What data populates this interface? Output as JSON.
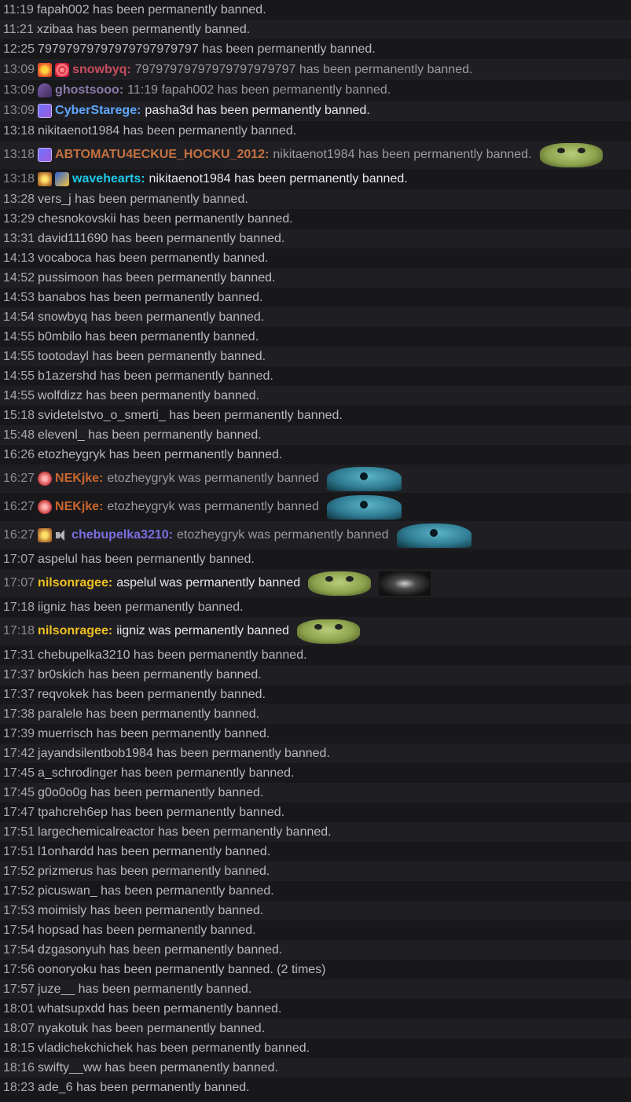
{
  "rows": [
    {
      "time": "11:19",
      "text": "fapah002 has been permanently banned."
    },
    {
      "time": "11:21",
      "text": "xzibaa has been permanently banned."
    },
    {
      "time": "12:25",
      "text": "79797979797979797979797 has been permanently banned."
    },
    {
      "time": "13:09",
      "user": "snowbyq:",
      "text": "79797979797979797979797 has been permanently banned."
    },
    {
      "time": "13:09",
      "user": "ghostsooo:",
      "text": "11:19 fapah002 has been permanently banned."
    },
    {
      "time": "13:09",
      "user": "CyberStarege:",
      "text": "pasha3d has been permanently banned."
    },
    {
      "time": "13:18",
      "text": "nikitaenot1984 has been permanently banned."
    },
    {
      "time": "13:18",
      "user": "ABTOMATU4ECKUE_HOCKU_2012:",
      "text": "nikitaenot1984 has been permanently banned."
    },
    {
      "time": "13:18",
      "user": "wavehearts:",
      "text": "nikitaenot1984 has been permanently banned."
    },
    {
      "time": "13:28",
      "text": "vers_j has been permanently banned."
    },
    {
      "time": "13:29",
      "text": "chesnokovskii has been permanently banned."
    },
    {
      "time": "13:31",
      "text": "david111690 has been permanently banned."
    },
    {
      "time": "14:13",
      "text": "vocaboca has been permanently banned."
    },
    {
      "time": "14:52",
      "text": "pussimoon has been permanently banned."
    },
    {
      "time": "14:53",
      "text": "banabos has been permanently banned."
    },
    {
      "time": "14:54",
      "text": "snowbyq has been permanently banned."
    },
    {
      "time": "14:55",
      "text": "b0mbilo has been permanently banned."
    },
    {
      "time": "14:55",
      "text": "tootodayl has been permanently banned."
    },
    {
      "time": "14:55",
      "text": "b1azershd has been permanently banned."
    },
    {
      "time": "14:55",
      "text": "wolfdizz has been permanently banned."
    },
    {
      "time": "15:18",
      "text": "svidetelstvo_o_smerti_ has been permanently banned."
    },
    {
      "time": "15:48",
      "text": "elevenl_ has been permanently banned."
    },
    {
      "time": "16:26",
      "text": "etozheygryk has been permanently banned."
    },
    {
      "time": "16:27",
      "user": "NEKjke:",
      "text": "etozheygryk was permanently banned"
    },
    {
      "time": "16:27",
      "user": "NEKjke:",
      "text": "etozheygryk was permanently banned"
    },
    {
      "time": "16:27",
      "user": "chebupelka3210:",
      "text": "etozheygryk was permanently banned"
    },
    {
      "time": "17:07",
      "text": "aspelul has been permanently banned."
    },
    {
      "time": "17:07",
      "user": "nilsonragee:",
      "text": "aspelul was permanently banned"
    },
    {
      "time": "17:18",
      "text": "iigniz has been permanently banned."
    },
    {
      "time": "17:18",
      "user": "nilsonragee:",
      "text": "iigniz was permanently banned"
    },
    {
      "time": "17:31",
      "text": "chebupelka3210 has been permanently banned."
    },
    {
      "time": "17:37",
      "text": "br0skich has been permanently banned."
    },
    {
      "time": "17:37",
      "text": "reqvokek has been permanently banned."
    },
    {
      "time": "17:38",
      "text": "paralele has been permanently banned."
    },
    {
      "time": "17:39",
      "text": "muerrisch has been permanently banned."
    },
    {
      "time": "17:42",
      "text": "jayandsilentbob1984 has been permanently banned."
    },
    {
      "time": "17:45",
      "text": "a_schrodinger has been permanently banned."
    },
    {
      "time": "17:45",
      "text": "g0o0o0g has been permanently banned."
    },
    {
      "time": "17:47",
      "text": "tpahcreh6ep has been permanently banned."
    },
    {
      "time": "17:51",
      "text": "largechemicalreactor has been permanently banned."
    },
    {
      "time": "17:51",
      "text": "l1onhardd has been permanently banned."
    },
    {
      "time": "17:52",
      "text": "prizmerus has been permanently banned."
    },
    {
      "time": "17:52",
      "text": "picuswan_ has been permanently banned."
    },
    {
      "time": "17:53",
      "text": "moimisly has been permanently banned."
    },
    {
      "time": "17:54",
      "text": "hopsad has been permanently banned."
    },
    {
      "time": "17:54",
      "text": "dzgasonyuh has been permanently banned."
    },
    {
      "time": "17:56",
      "text": "oonoryoku has been permanently banned. (2 times)"
    },
    {
      "time": "17:57",
      "text": "juze__ has been permanently banned."
    },
    {
      "time": "18:01",
      "text": "whatsupxdd has been permanently banned."
    },
    {
      "time": "18:07",
      "text": "nyakotuk has been permanently banned."
    },
    {
      "time": "18:15",
      "text": "vladichekchichek has been permanently banned."
    },
    {
      "time": "18:16",
      "text": "swifty__ww has been permanently banned."
    },
    {
      "time": "18:23",
      "text": "ade_6 has been permanently banned."
    }
  ],
  "user_colors": {
    "snowbyq": "#c94c5e",
    "ghostsooo": "#8a7aa8",
    "CyberStarege": "#5fa8ff",
    "ABTOMATU4ECKUE_HOCKU_2012": "#c47040",
    "wavehearts": "#1ec8e8",
    "NEKjke": "#c8662e",
    "chebupelka3210": "#7b6fe0",
    "nilsonragee": "#f0c020"
  },
  "icons": [
    "star-badge-icon",
    "target-badge-icon",
    "witch-badge-icon",
    "sub-badge-icon",
    "heart-badge-icon",
    "heart-red-badge-icon",
    "spark-badge-icon",
    "mute-badge-icon",
    "frog-emote-icon",
    "blue-creature-emote-icon",
    "dark-emote-icon"
  ]
}
